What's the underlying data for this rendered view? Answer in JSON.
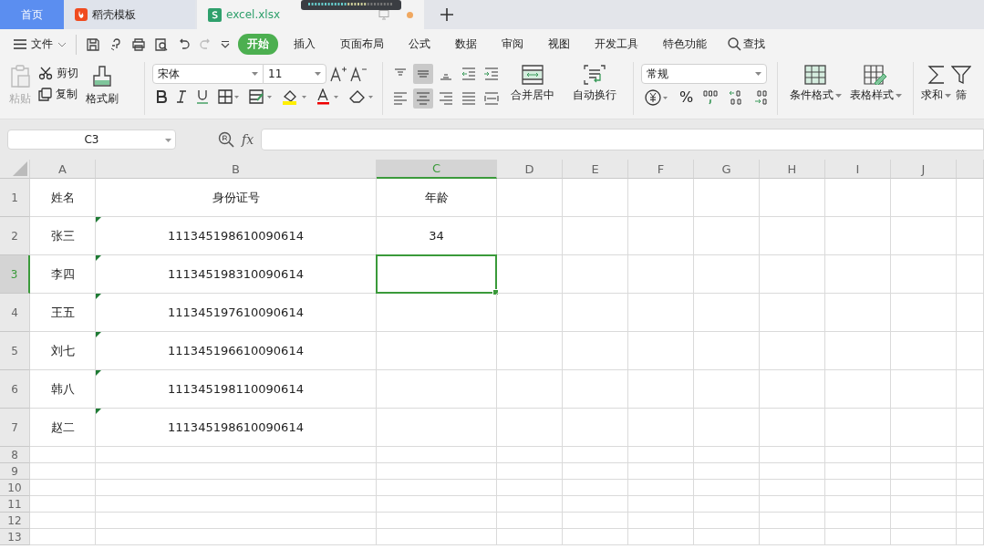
{
  "tabs": [
    {
      "label": "首页",
      "kind": "home",
      "selected": false
    },
    {
      "label": "稻壳模板",
      "kind": "docer",
      "selected": false
    },
    {
      "label": "excel.xlsx",
      "kind": "sheet",
      "selected": true
    }
  ],
  "menu": {
    "file": "文件",
    "items": [
      {
        "label": "开始",
        "selected": true
      },
      {
        "label": "插入",
        "selected": false
      },
      {
        "label": "页面布局",
        "selected": false
      },
      {
        "label": "公式",
        "selected": false
      },
      {
        "label": "数据",
        "selected": false
      },
      {
        "label": "审阅",
        "selected": false
      },
      {
        "label": "视图",
        "selected": false
      },
      {
        "label": "开发工具",
        "selected": false
      },
      {
        "label": "特色功能",
        "selected": false
      }
    ],
    "search": "查找"
  },
  "ribbon": {
    "paste": {
      "label": "粘贴",
      "disabled": true
    },
    "cut": "剪切",
    "copy": "复制",
    "format_painter": "格式刷",
    "font_name": "宋体",
    "font_size": "11",
    "merge": "合并居中",
    "wrap": "自动换行",
    "number_format": "常规",
    "percent": "%",
    "conditional_format": "条件格式",
    "table_style": "表格样式",
    "sum": "求和",
    "filter": "筛"
  },
  "formula_bar": {
    "name_box": "C3",
    "fx": "fx"
  },
  "columns": [
    {
      "label": "A",
      "selected": false
    },
    {
      "label": "B",
      "selected": false
    },
    {
      "label": "C",
      "selected": true
    },
    {
      "label": "D",
      "selected": false
    },
    {
      "label": "E",
      "selected": false
    },
    {
      "label": "F",
      "selected": false
    },
    {
      "label": "G",
      "selected": false
    },
    {
      "label": "H",
      "selected": false
    },
    {
      "label": "I",
      "selected": false
    },
    {
      "label": "J",
      "selected": false
    }
  ],
  "rows": [
    {
      "number": "1",
      "cells": [
        "姓名",
        "身份证号",
        "年龄"
      ],
      "flagged": false,
      "selected": false
    },
    {
      "number": "2",
      "cells": [
        "张三",
        "111345198610090614",
        "34"
      ],
      "flagged": true,
      "selected": false
    },
    {
      "number": "3",
      "cells": [
        "李四",
        "111345198310090614",
        ""
      ],
      "flagged": true,
      "selected": true
    },
    {
      "number": "4",
      "cells": [
        "王五",
        "111345197610090614",
        ""
      ],
      "flagged": true,
      "selected": false
    },
    {
      "number": "5",
      "cells": [
        "刘七",
        "111345196610090614",
        ""
      ],
      "flagged": true,
      "selected": false
    },
    {
      "number": "6",
      "cells": [
        "韩八",
        "111345198110090614",
        ""
      ],
      "flagged": true,
      "selected": false
    },
    {
      "number": "7",
      "cells": [
        "赵二",
        "111345198610090614",
        ""
      ],
      "flagged": true,
      "selected": false
    },
    {
      "number": "8",
      "cells": [],
      "flagged": false,
      "selected": false
    },
    {
      "number": "9",
      "cells": [],
      "flagged": false,
      "selected": false
    },
    {
      "number": "10",
      "cells": [],
      "flagged": false,
      "selected": false
    },
    {
      "number": "11",
      "cells": [],
      "flagged": false,
      "selected": false
    },
    {
      "number": "12",
      "cells": [],
      "flagged": false,
      "selected": false
    },
    {
      "number": "13",
      "cells": [],
      "flagged": false,
      "selected": false
    }
  ]
}
